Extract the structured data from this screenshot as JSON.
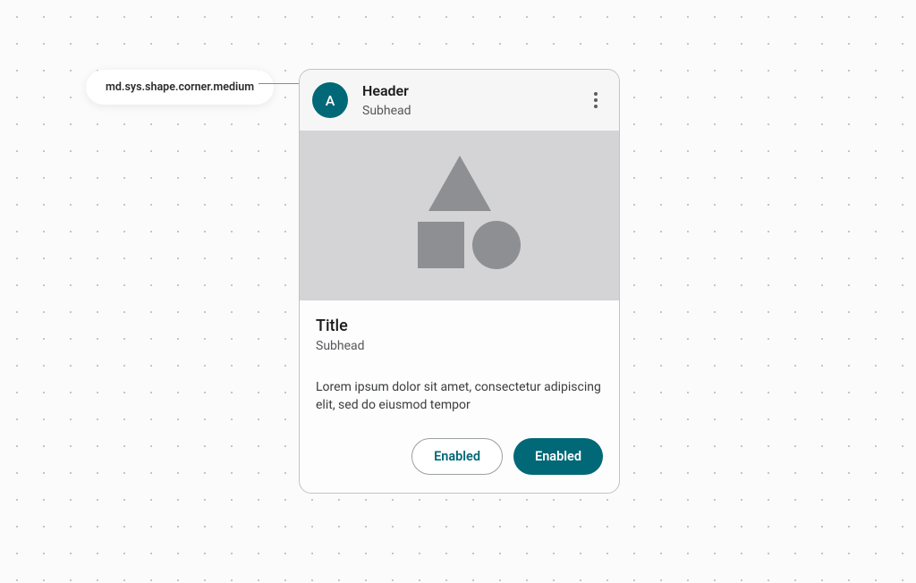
{
  "token_label": "md.sys.shape.corner.medium",
  "card": {
    "header": {
      "avatar_initial": "A",
      "title": "Header",
      "subhead": "Subhead"
    },
    "body": {
      "title": "Title",
      "subhead": "Subhead",
      "supporting_text": "Lorem ipsum dolor sit amet, consectetur adipiscing elit, sed do eiusmod tempor"
    },
    "actions": {
      "outlined_label": "Enabled",
      "filled_label": "Enabled"
    }
  },
  "colors": {
    "primary": "#006876"
  }
}
